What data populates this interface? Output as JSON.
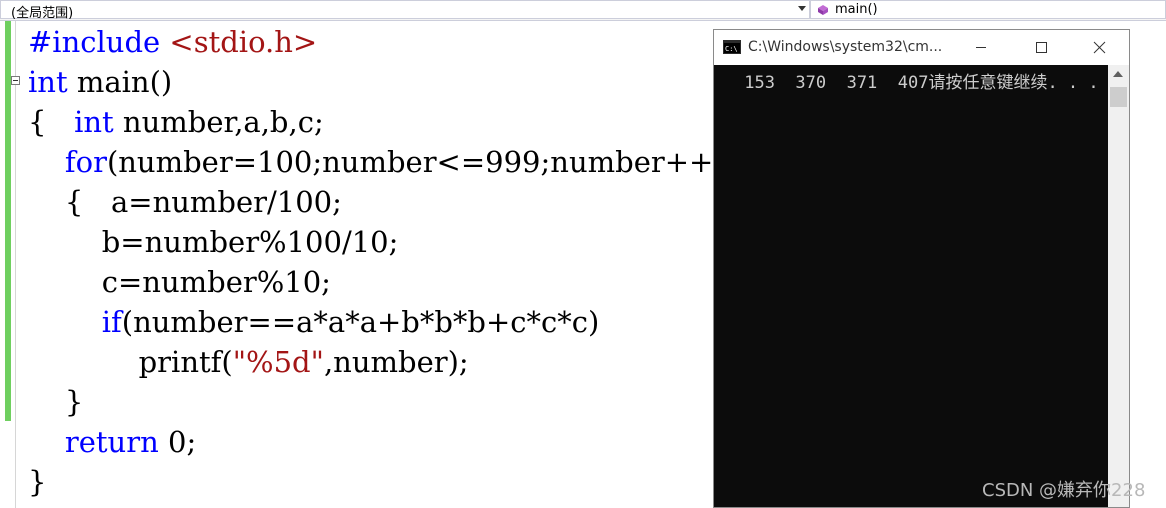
{
  "navbar": {
    "scope_label": "(全局范围)",
    "member_label": "main()"
  },
  "code": {
    "lines": [
      [
        {
          "t": "#include ",
          "c": "pp"
        },
        {
          "t": "<stdio.h>",
          "c": "inc"
        }
      ],
      [
        {
          "t": "int",
          "c": "kw"
        },
        {
          "t": " main()",
          "c": ""
        }
      ],
      [
        {
          "t": "{   ",
          "c": ""
        },
        {
          "t": "int",
          "c": "kw"
        },
        {
          "t": " number,a,b,c;",
          "c": ""
        }
      ],
      [
        {
          "t": "    ",
          "c": ""
        },
        {
          "t": "for",
          "c": "kw"
        },
        {
          "t": "(number=100;number<=999;number++)",
          "c": ""
        }
      ],
      [
        {
          "t": "    {   a=number/100;",
          "c": ""
        }
      ],
      [
        {
          "t": "        b=number%100/10;",
          "c": ""
        }
      ],
      [
        {
          "t": "        c=number%10;",
          "c": ""
        }
      ],
      [
        {
          "t": "        ",
          "c": ""
        },
        {
          "t": "if",
          "c": "kw"
        },
        {
          "t": "(number==a*a*a+b*b*b+c*c*c)",
          "c": ""
        }
      ],
      [
        {
          "t": "            printf(",
          "c": ""
        },
        {
          "t": "\"%5d\"",
          "c": "str"
        },
        {
          "t": ",number);",
          "c": ""
        }
      ],
      [
        {
          "t": "    }",
          "c": ""
        }
      ],
      [
        {
          "t": "    ",
          "c": ""
        },
        {
          "t": "return",
          "c": "kw"
        },
        {
          "t": " 0;",
          "c": ""
        }
      ],
      [
        {
          "t": "}",
          "c": ""
        }
      ]
    ]
  },
  "console": {
    "title": "C:\\Windows\\system32\\cm...",
    "output": " 153  370  371  407请按任意键继续. . .",
    "icons": [
      "console-app-icon",
      "minimize-icon",
      "maximize-icon",
      "close-icon"
    ]
  },
  "watermark": "CSDN @嫌弃你228",
  "colors": {
    "keyword": "#0000ff",
    "string": "#a31515",
    "change_bar": "#6fcf5f",
    "console_bg": "#0c0c0c",
    "console_text": "#cccccc"
  }
}
